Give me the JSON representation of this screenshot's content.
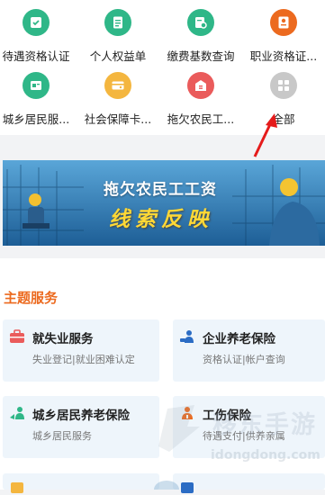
{
  "quick_grid": {
    "items": [
      {
        "label": "待遇资格认证",
        "icon": "badge-check-icon",
        "color": "#2fb788"
      },
      {
        "label": "个人权益单",
        "icon": "document-icon",
        "color": "#2fb788"
      },
      {
        "label": "缴费基数查询",
        "icon": "payment-search-icon",
        "color": "#2fb788"
      },
      {
        "label": "职业资格证...",
        "icon": "certificate-icon",
        "color": "#ec6a1f"
      },
      {
        "label": "城乡居民服...",
        "icon": "resident-service-icon",
        "color": "#2fb788"
      },
      {
        "label": "社会保障卡...",
        "icon": "social-card-icon",
        "color": "#f4b63f"
      },
      {
        "label": "拖欠农民工...",
        "icon": "wage-report-icon",
        "color": "#ea5b5b"
      },
      {
        "label": "全部",
        "icon": "all-grid-icon",
        "color": "#c8c8c8"
      }
    ]
  },
  "banner": {
    "title": "拖欠农民工工资",
    "subtitle": "线索反映"
  },
  "theme_services": {
    "title": "主题服务",
    "items": [
      {
        "title": "就失业服务",
        "desc": "失业登记|就业困难认定",
        "icon": "briefcase-icon",
        "color": "#ea5b5b"
      },
      {
        "title": "企业养老保险",
        "desc": "资格认证|帐户查询",
        "icon": "elder-care-icon",
        "color": "#2b6cc4"
      },
      {
        "title": "城乡居民养老保险",
        "desc": "城乡居民服务",
        "icon": "resident-pension-icon",
        "color": "#2fb788"
      },
      {
        "title": "工伤保险",
        "desc": "待遇支付|供养亲属",
        "icon": "injury-insurance-icon",
        "color": "#ec6a1f"
      }
    ]
  },
  "watermark": {
    "text": "移东手游",
    "url": "idongdong.com"
  }
}
